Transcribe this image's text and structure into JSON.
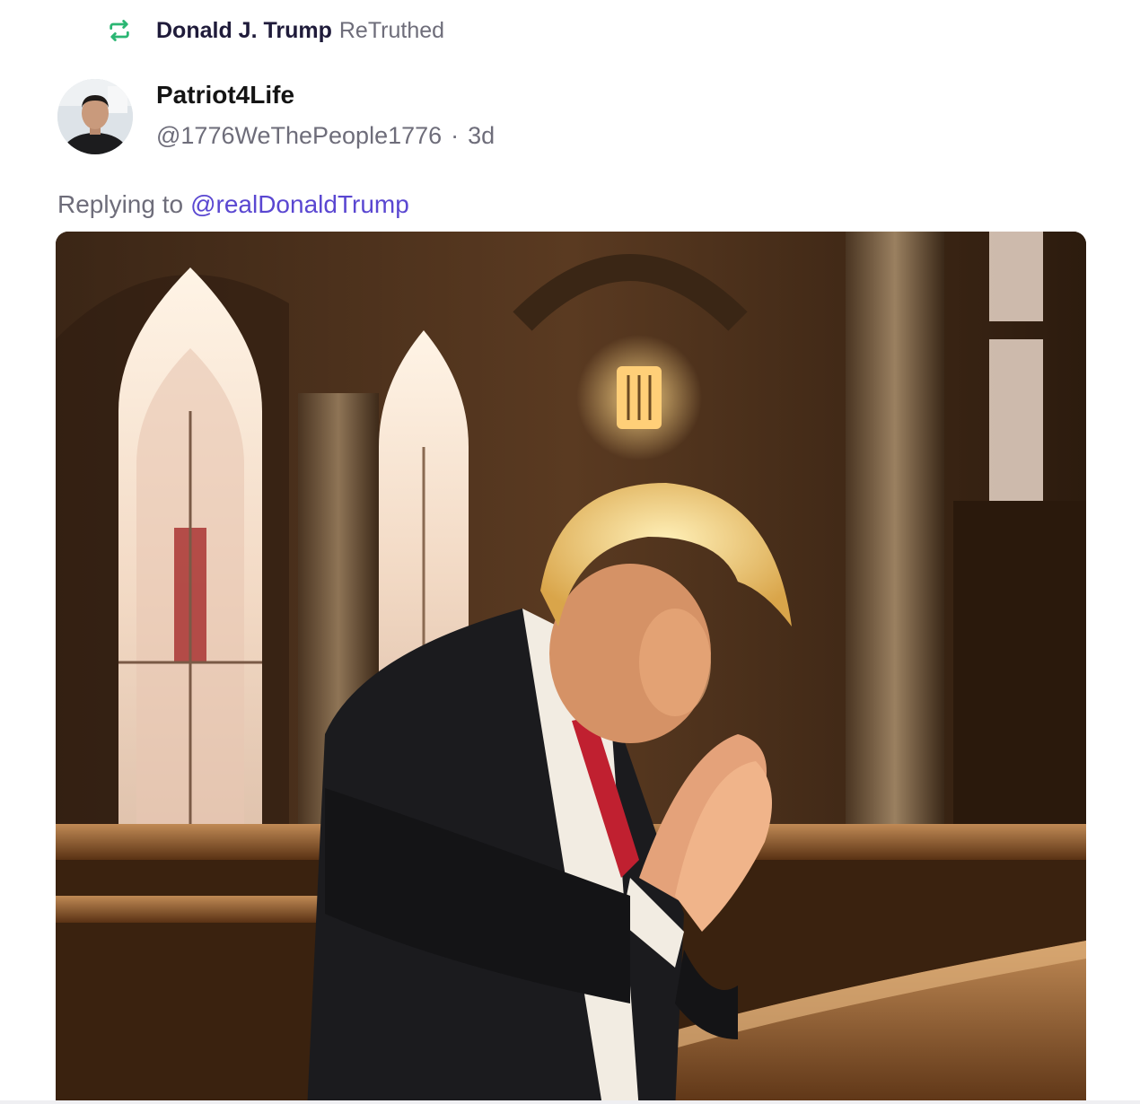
{
  "retruth": {
    "icon": "retruth-icon",
    "icon_color": "#2bb673",
    "name": "Donald J. Trump",
    "action": "ReTruthed"
  },
  "author": {
    "avatar": "avatar",
    "display_name": "Patriot4Life",
    "handle": "@1776WeThePeople1776",
    "separator": "·",
    "time_ago": "3d"
  },
  "reply": {
    "prefix": "Replying to",
    "mention": "@realDonaldTrump",
    "mention_color": "#5a47d1"
  },
  "media": {
    "kind": "image",
    "alt": ""
  }
}
